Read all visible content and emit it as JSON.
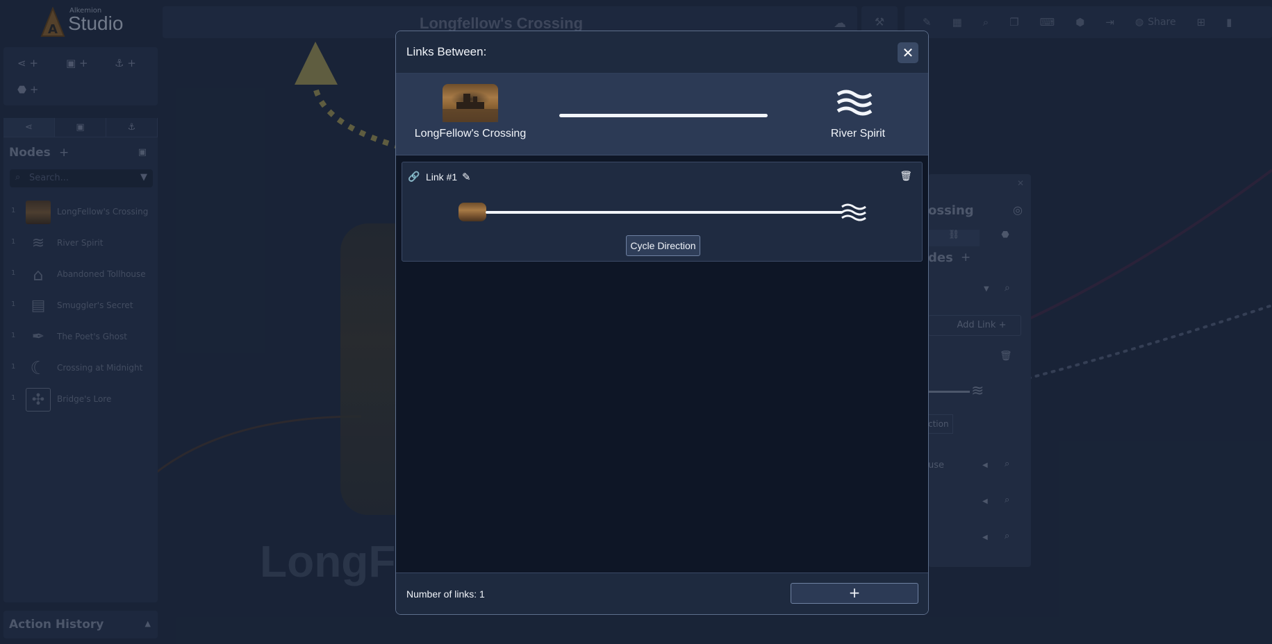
{
  "app": {
    "logo_small": "Alkemion",
    "logo_big": "Studio",
    "title": "Longfellow's Crossing",
    "share_label": "Share"
  },
  "sidebar": {
    "nodes_heading": "Nodes",
    "search_placeholder": "Search...",
    "nodes": [
      {
        "count": "1",
        "label": "LongFellow's Crossing"
      },
      {
        "count": "1",
        "label": "River Spirit"
      },
      {
        "count": "1",
        "label": "Abandoned Tollhouse"
      },
      {
        "count": "1",
        "label": "Smuggler's Secret"
      },
      {
        "count": "1",
        "label": "The Poet's Ghost"
      },
      {
        "count": "1",
        "label": "Crossing at Midnight"
      },
      {
        "count": "1",
        "label": "Bridge's Lore"
      }
    ],
    "action_history": "Action History"
  },
  "canvas": {
    "big_title_fragment": "LongFe"
  },
  "float_panel": {
    "title_fragment": "ossing",
    "nodes_fragment": "des",
    "add_link": "Add Link",
    "cycle_fragment": "ction",
    "row1_fragment": "use"
  },
  "modal": {
    "title": "Links Between:",
    "left_node": "LongFellow's Crossing",
    "right_node": "River Spirit",
    "links": [
      {
        "name": "Link #1",
        "cycle_label": "Cycle Direction"
      }
    ],
    "count_label": "Number of links: 1",
    "add_label": "+"
  },
  "colors": {
    "background": "#1f2c43",
    "modal_bg": "#0e1626",
    "band_bg": "#2c3a55",
    "accent_arrow": "#8a8450"
  }
}
